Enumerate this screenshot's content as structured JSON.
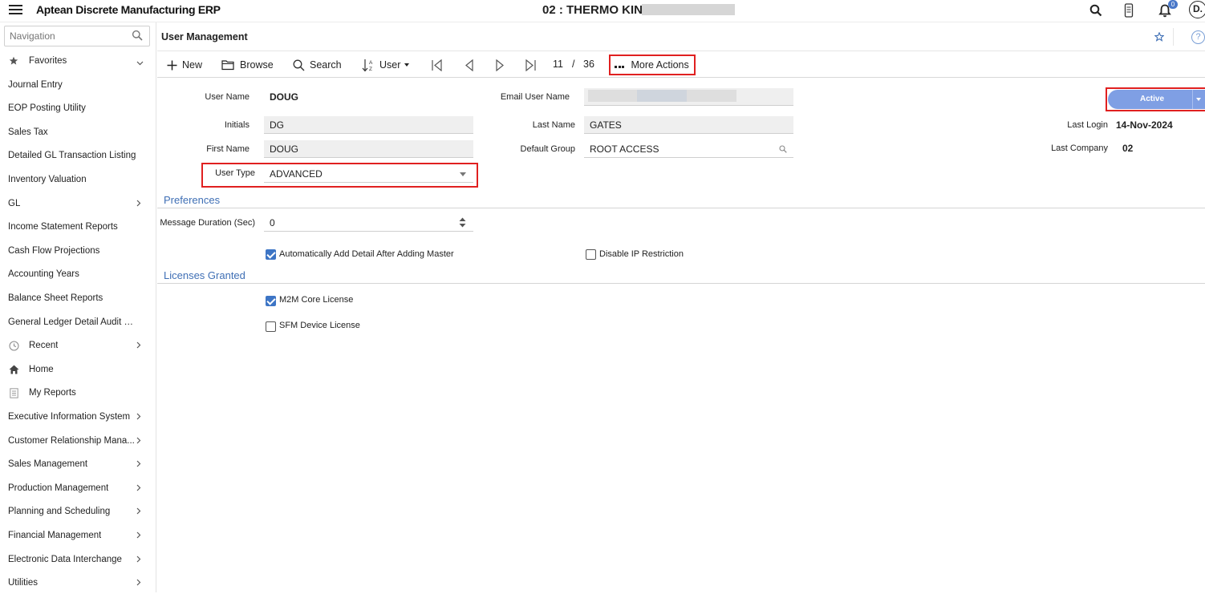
{
  "app": {
    "title": "Aptean Discrete Manufacturing ERP",
    "company": "02 : THERMO KING",
    "notifications_count": "0",
    "avatar_initials": "D."
  },
  "nav": {
    "search_placeholder": "Navigation",
    "items": [
      {
        "label": "Favorites",
        "icon": "star-icon",
        "chevron": "down"
      },
      {
        "label": "Journal Entry"
      },
      {
        "label": "EOP Posting Utility"
      },
      {
        "label": "Sales Tax"
      },
      {
        "label": "Detailed GL Transaction Listing"
      },
      {
        "label": "Inventory Valuation"
      },
      {
        "label": "GL",
        "chevron": "right"
      },
      {
        "label": "Income Statement Reports"
      },
      {
        "label": "Cash Flow Projections"
      },
      {
        "label": "Accounting Years"
      },
      {
        "label": "Balance Sheet Reports"
      },
      {
        "label": "General Ledger Detail Audit Rep..."
      },
      {
        "label": "Recent",
        "icon": "clock-icon",
        "chevron": "right"
      },
      {
        "label": "Home",
        "icon": "home-icon"
      },
      {
        "label": "My Reports",
        "icon": "report-icon"
      },
      {
        "label": "Executive Information System",
        "chevron": "right"
      },
      {
        "label": "Customer Relationship Mana...",
        "chevron": "right"
      },
      {
        "label": "Sales Management",
        "chevron": "right"
      },
      {
        "label": "Production Management",
        "chevron": "right"
      },
      {
        "label": "Planning and Scheduling",
        "chevron": "right"
      },
      {
        "label": "Financial Management",
        "chevron": "right"
      },
      {
        "label": "Electronic Data Interchange",
        "chevron": "right"
      },
      {
        "label": "Utilities",
        "chevron": "right"
      }
    ]
  },
  "page": {
    "title": "User Management"
  },
  "toolbar": {
    "new": "New",
    "browse": "Browse",
    "search": "Search",
    "sort": "User",
    "record_current": "11",
    "record_sep": "/",
    "record_total": "36",
    "more_actions": "More Actions"
  },
  "form": {
    "user_name_label": "User Name",
    "user_name": "DOUG",
    "initials_label": "Initials",
    "initials": "DG",
    "first_name_label": "First Name",
    "first_name": "DOUG",
    "user_type_label": "User Type",
    "user_type": "ADVANCED",
    "email_label": "Email User Name",
    "last_name_label": "Last Name",
    "last_name": "GATES",
    "default_group_label": "Default Group",
    "default_group": "ROOT ACCESS",
    "status": "Active",
    "last_login_label": "Last Login",
    "last_login": "14-Nov-2024",
    "last_company_label": "Last Company",
    "last_company": "02"
  },
  "preferences": {
    "title": "Preferences",
    "message_duration_label": "Message Duration (Sec)",
    "message_duration": "0",
    "auto_add_detail_label": "Automatically Add Detail After Adding Master",
    "auto_add_detail": true,
    "disable_ip_label": "Disable IP Restriction",
    "disable_ip": false
  },
  "licenses": {
    "title": "Licenses Granted",
    "m2m_core_label": "M2M Core License",
    "m2m_core": true,
    "sfm_device_label": "SFM Device License",
    "sfm_device": false
  },
  "colors": {
    "accent": "#3f6fb5",
    "highlight": "#e02020",
    "status_button": "#7f9fe4"
  }
}
